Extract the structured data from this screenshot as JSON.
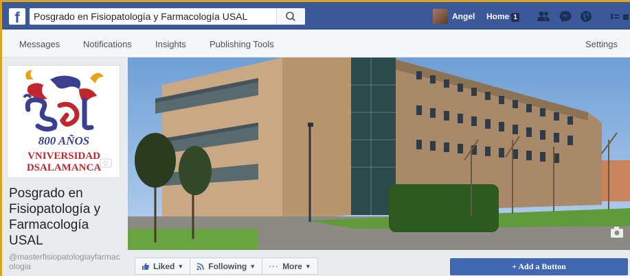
{
  "topbar": {
    "logo": "f",
    "search_value": "Posgrado en Fisiopatología y Farmacología USAL",
    "search_icon": "search-icon",
    "user_name": "Angel",
    "home_label": "Home",
    "home_count": "1",
    "icons": [
      "friends-icon",
      "messenger-icon",
      "globe-icon",
      "settings-menu-icon"
    ],
    "brand_color": "#3b5998"
  },
  "pagenav": {
    "items": [
      "Messages",
      "Notifications",
      "Insights",
      "Publishing Tools"
    ],
    "settings": "Settings"
  },
  "profile": {
    "logo_line1": "USal",
    "logo_line2": "800 AÑOS",
    "logo_line3": "VNIVERSIDAD",
    "logo_line4": "DSALAMANCA",
    "page_name": "Posgrado en Fisiopatología y Farmacología USAL",
    "handle": "@masterfisiopatologiayfarmacologia"
  },
  "actions": {
    "liked": "Liked",
    "following": "Following",
    "more": "More",
    "add_button": "+ Add a Button"
  }
}
